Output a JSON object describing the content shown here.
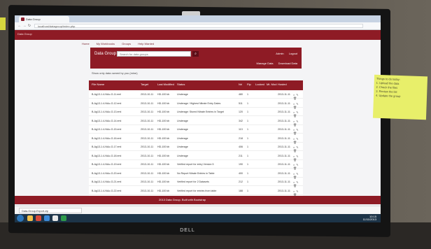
{
  "browser": {
    "tab_title": "Data Group",
    "address": "localhost/datagroup/index.php"
  },
  "site": {
    "logo_text": "Data Group"
  },
  "nav": {
    "items": [
      "Home",
      "My Workbooks",
      "Groups",
      "Help Wanted"
    ]
  },
  "hero": {
    "title": "Data Group",
    "search_placeholder": "Search for data groups",
    "actions": [
      "Admin",
      "Logout"
    ],
    "subline": "",
    "buttons": [
      "Manage Data",
      "Download Data"
    ]
  },
  "filter": {
    "text": "Show only data owned by you (mine)"
  },
  "table": {
    "headers": [
      "File Name",
      "Target",
      "Last Modified",
      "Status",
      "Nrl",
      "Ftp",
      "Locked",
      "Mt. Mod",
      "Hosted",
      "",
      "",
      ""
    ],
    "rows": [
      [
        "B-Ag13-1.4-NAo-G-11.eml",
        "2013-10-11",
        "HD-100 kb",
        "Underage",
        "480",
        "1",
        "2013-11-11"
      ],
      [
        "B-Ag13-1.4-NAo-G-12.eml",
        "2013-10-11",
        "HD-100 kb",
        "Underage / Highest Nitrate Entry Dates",
        "511",
        "1",
        "2013-11-11"
      ],
      [
        "B-Ag13-1.4-NAo-G-13.eml",
        "2013-10-11",
        "HD-100 kb",
        "Underage: Stored Nitrate Entries in Target",
        "120",
        "1",
        "2013-11-11"
      ],
      [
        "B-Ag13-1.4-NAo-G-14.eml",
        "2013-10-11",
        "HD-100 kb",
        "Underage",
        "342",
        "1",
        "2013-11-11"
      ],
      [
        "B-Ag13-1.4-NAo-G-15.eml",
        "2013-10-11",
        "HD-100 kb",
        "Underage",
        "113",
        "1",
        "2013-11-11"
      ],
      [
        "B-Ag13-1.4-NAo-G-16.eml",
        "2013-10-11",
        "HD-100 kb",
        "Underage",
        "218",
        "1",
        "2013-11-11"
      ],
      [
        "B-Ag13-1.4-NAo-G-17.eml",
        "2013-10-11",
        "HD-100 kb",
        "Underage",
        "406",
        "1",
        "2013-11-11"
      ],
      [
        "B-Ag13-1.4-NAo-G-18.eml",
        "2013-10-11",
        "HD-100 kb",
        "Underage",
        "211",
        "1",
        "2013-11-11"
      ],
      [
        "B-Ag13-1.4-NAo-G-19.eml",
        "2013-10-11",
        "HD-100 kb",
        "Verified report for entry Version 5",
        "190",
        "1",
        "2013-11-11"
      ],
      [
        "B-Ag13-1.4-NAo-G-20.eml",
        "2013-10-11",
        "HD-100 kb",
        "No Report Nitrate Entries in Table",
        "400",
        "1",
        "2013-11-11"
      ],
      [
        "B-Ag13-1.4-NAo-G-21.eml",
        "2013-10-11",
        "HD-100 kb",
        "Verified report for 2 Datasets",
        "212",
        "1",
        "2013-11-11"
      ],
      [
        "B-Ag13-1.4-NAo-G-22.eml",
        "2013-10-11",
        "HD-100 kb",
        "Verified report for entries from table",
        "188",
        "1",
        "2013-11-11"
      ]
    ]
  },
  "footer": {
    "text": "2013 Data Group. Built with Bootstrap"
  },
  "downloads": {
    "item": "Data-Group-Export.zip"
  },
  "taskbar": {
    "time": "10:15",
    "date": "11/11/2013"
  },
  "sticky_note": {
    "lines": [
      "Things to do today:",
      "1. Upload the data",
      "2. Check the files",
      "3. Review the list",
      "4. Update the group"
    ]
  },
  "monitor": {
    "brand": "DELL"
  },
  "colors": {
    "brand_red": "#8e1b25",
    "taskbar": "#1d3448"
  }
}
